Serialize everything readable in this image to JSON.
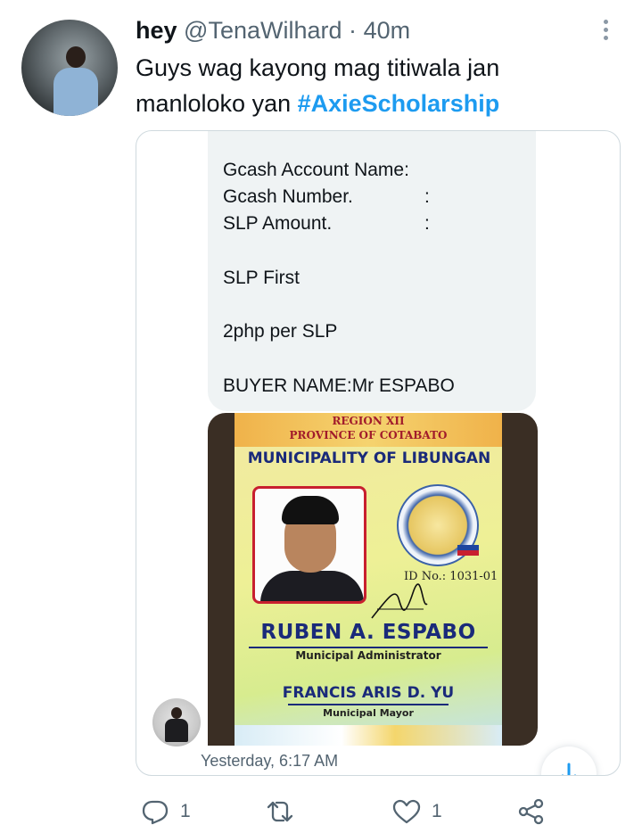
{
  "tweet": {
    "display_name": "hey",
    "handle": "@TenaWilhard",
    "separator": "·",
    "time_ago": "40m",
    "text_line1": "Guys wag kayong mag titiwala jan",
    "text_line2_prefix": "manloloko yan ",
    "hashtag": "#AxieScholarship"
  },
  "message": {
    "lines": [
      "Gcash Account Name:",
      "Gcash Number.",
      "SLP Amount.",
      "SLP First",
      "2php per SLP",
      "BUYER NAME:Mr ESPABO"
    ],
    "colon": ":",
    "timestamp": "Yesterday, 6:17 AM"
  },
  "id_card": {
    "region": "REGION XII",
    "province": "PROVINCE OF COTABATO",
    "municipality": "MUNICIPALITY OF LIBUNGAN",
    "seal_text": "SAGISAG NG BAYAN NG LIBUNGAN",
    "id_number": "ID No.: 1031-01",
    "holder_name": "RUBEN A. ESPABO",
    "holder_title": "Municipal Administrator",
    "mayor_name": "FRANCIS ARIS D. YU",
    "mayor_title": "Municipal Mayor"
  },
  "actions": {
    "reply_count": "1",
    "like_count": "1"
  },
  "icons": {
    "more": "more-vertical-icon",
    "reply": "reply-icon",
    "retweet": "retweet-icon",
    "like": "like-icon",
    "share": "share-icon",
    "scroll": "arrow-down-icon"
  },
  "colors": {
    "accent": "#1d9bf0",
    "text": "#0f1419",
    "secondary": "#536471",
    "bubble": "#eff3f4",
    "border": "#cfd9de"
  }
}
